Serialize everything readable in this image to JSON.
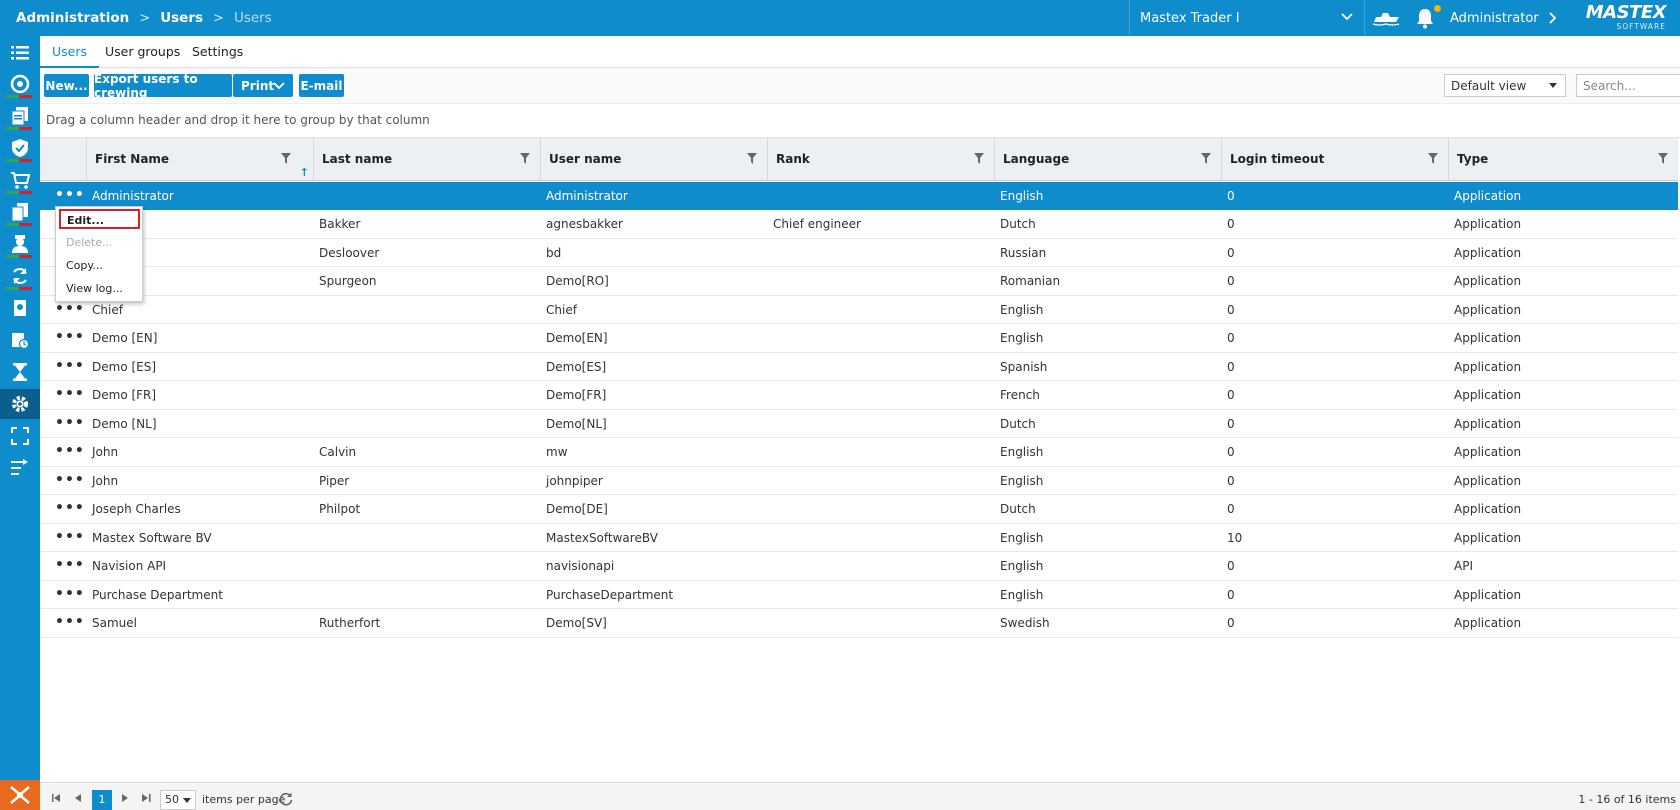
{
  "header": {
    "breadcrumbs": [
      "Administration",
      "Users",
      "Users"
    ],
    "vessel": "Mastex Trader I",
    "user": "Administrator",
    "logo_text": "MASTEX",
    "logo_sub": "SOFTWARE"
  },
  "sidenav": {
    "icons": [
      "list-icon",
      "dashboard-icon",
      "documents-icon",
      "safety-icon",
      "purchase-icon",
      "copy-icon",
      "crew-icon",
      "sync-icon",
      "certificate-icon",
      "report-icon",
      "hourglass-icon",
      "settings-icon",
      "fullscreen-icon",
      "transfer-icon"
    ],
    "active": "settings-icon"
  },
  "tabs": [
    "Users",
    "User groups",
    "Settings"
  ],
  "active_tab": "Users",
  "toolbar": {
    "new_label": "New...",
    "export_label": "Export users to crewing",
    "print_label": "Print",
    "email_label": "E-mail",
    "view_label": "Default view",
    "search_placeholder": "Search..."
  },
  "group_hint": "Drag a column header and drop it here to group by that column",
  "columns": [
    "First Name",
    "Last name",
    "User name",
    "Rank",
    "Language",
    "Login timeout",
    "Type"
  ],
  "rows": [
    {
      "first": "Administrator",
      "last": "",
      "user": "Administrator",
      "rank": "",
      "lang": "English",
      "timeout": "0",
      "type": "Application"
    },
    {
      "first": "",
      "last": "Bakker",
      "user": "agnesbakker",
      "rank": "Chief engineer",
      "lang": "Dutch",
      "timeout": "0",
      "type": "Application"
    },
    {
      "first": "",
      "last": "Desloover",
      "user": "bd",
      "rank": "",
      "lang": "Russian",
      "timeout": "0",
      "type": "Application"
    },
    {
      "first": "",
      "last": "Spurgeon",
      "user": "Demo[RO]",
      "rank": "",
      "lang": "Romanian",
      "timeout": "0",
      "type": "Application"
    },
    {
      "first": "Chief",
      "last": "",
      "user": "Chief",
      "rank": "",
      "lang": "English",
      "timeout": "0",
      "type": "Application"
    },
    {
      "first": "Demo [EN]",
      "last": "",
      "user": "Demo[EN]",
      "rank": "",
      "lang": "English",
      "timeout": "0",
      "type": "Application"
    },
    {
      "first": "Demo [ES]",
      "last": "",
      "user": "Demo[ES]",
      "rank": "",
      "lang": "Spanish",
      "timeout": "0",
      "type": "Application"
    },
    {
      "first": "Demo [FR]",
      "last": "",
      "user": "Demo[FR]",
      "rank": "",
      "lang": "French",
      "timeout": "0",
      "type": "Application"
    },
    {
      "first": "Demo [NL]",
      "last": "",
      "user": "Demo[NL]",
      "rank": "",
      "lang": "Dutch",
      "timeout": "0",
      "type": "Application"
    },
    {
      "first": "John",
      "last": "Calvin",
      "user": "mw",
      "rank": "",
      "lang": "English",
      "timeout": "0",
      "type": "Application"
    },
    {
      "first": "John",
      "last": "Piper",
      "user": "johnpiper",
      "rank": "",
      "lang": "English",
      "timeout": "0",
      "type": "Application"
    },
    {
      "first": "Joseph Charles",
      "last": "Philpot",
      "user": "Demo[DE]",
      "rank": "",
      "lang": "Dutch",
      "timeout": "0",
      "type": "Application"
    },
    {
      "first": "Mastex Software BV",
      "last": "",
      "user": "MastexSoftwareBV",
      "rank": "",
      "lang": "English",
      "timeout": "10",
      "type": "Application"
    },
    {
      "first": "Navision API",
      "last": "",
      "user": "navisionapi",
      "rank": "",
      "lang": "English",
      "timeout": "0",
      "type": "API"
    },
    {
      "first": "Purchase Department",
      "last": "",
      "user": "PurchaseDepartment",
      "rank": "",
      "lang": "English",
      "timeout": "0",
      "type": "Application"
    },
    {
      "first": "Samuel",
      "last": "Rutherfort",
      "user": "Demo[SV]",
      "rank": "",
      "lang": "Swedish",
      "timeout": "0",
      "type": "Application"
    }
  ],
  "row_actions_label": "•••",
  "context_menu": {
    "edit": "Edit...",
    "delete": "Delete...",
    "copy": "Copy...",
    "view_log": "View log..."
  },
  "pager": {
    "current_page": "1",
    "page_size": "50",
    "per_page_label": "items per page",
    "info": "1 - 16 of 16 items"
  },
  "colors": {
    "primary": "#0e8ccc",
    "active_nav": "#0a5f8d",
    "highlight_border": "#d2232a",
    "notification": "#f7b500"
  }
}
